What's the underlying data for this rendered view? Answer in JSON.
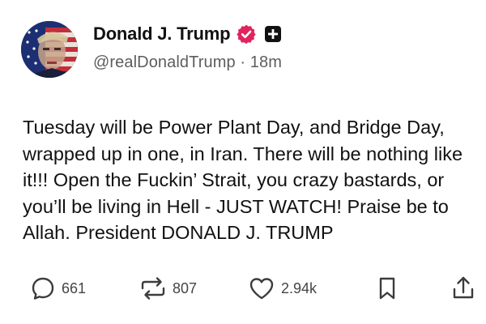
{
  "post": {
    "author": {
      "display_name": "Donald J. Trump",
      "handle": "@realDonaldTrump",
      "separator": "·",
      "time_ago": "18m",
      "verified": true
    },
    "text_lines": [
      "Tuesday will be Power Plant Day, and Bridge Day,",
      "wrapped up in one, in Iran. There will be nothing like",
      "it!!! Open the Fuckin’ Strait, you crazy bastards, or",
      "you’ll be living in Hell - JUST WATCH! Praise be to",
      "Allah. President DONALD J. TRUMP"
    ],
    "actions": {
      "replies": "661",
      "reposts": "807",
      "likes": "2.94k"
    }
  },
  "icons": {
    "reply": "reply-bubble-icon",
    "repost": "repost-arrows-icon",
    "like": "heart-icon",
    "bookmark": "bookmark-icon",
    "share": "share-upload-icon",
    "verified": "verified-badge-icon",
    "plus": "plus-badge-icon"
  },
  "colors": {
    "verified_badge": "#e0245e",
    "text": "#111111",
    "secondary_text": "#5d5d5d",
    "icon": "#3c3c3c"
  }
}
